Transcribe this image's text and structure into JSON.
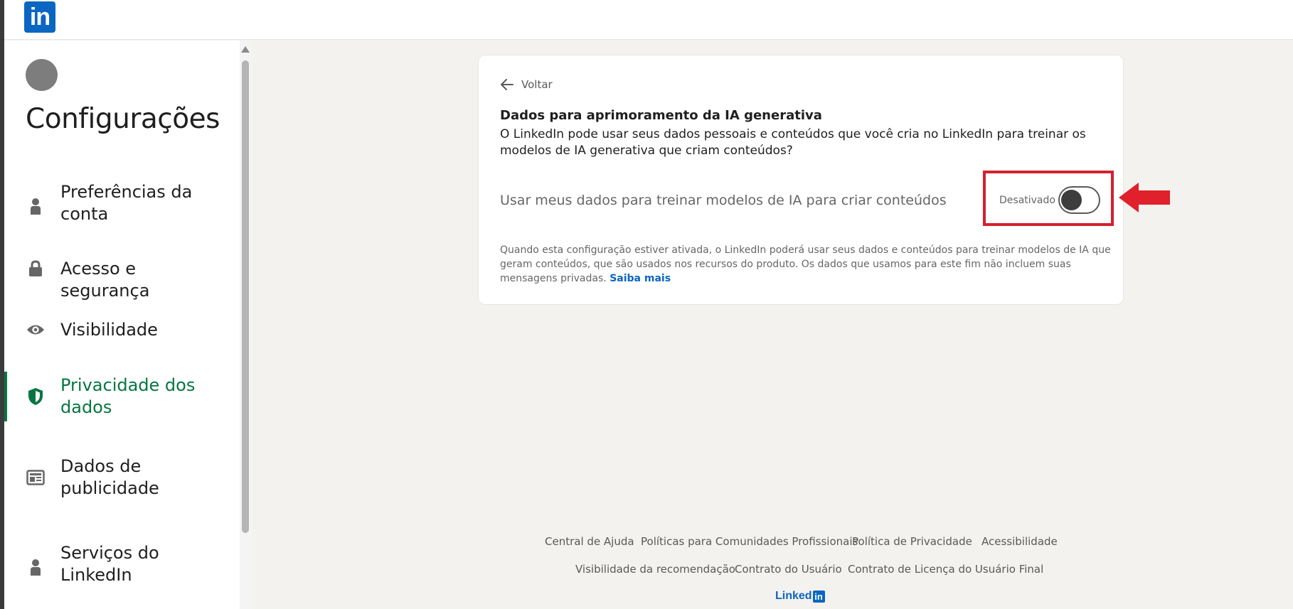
{
  "header": {
    "logo_text": "in"
  },
  "sidebar": {
    "title": "Configurações",
    "items": [
      {
        "label": "Preferências da conta",
        "icon": "person-icon",
        "active": false
      },
      {
        "label": "Acesso e segurança",
        "icon": "lock-icon",
        "active": false
      },
      {
        "label": "Visibilidade",
        "icon": "eye-icon",
        "active": false
      },
      {
        "label": "Privacidade dos dados",
        "icon": "shield-icon",
        "active": true
      },
      {
        "label": "Dados de publicidade",
        "icon": "newspaper-icon",
        "active": false
      },
      {
        "label": "Serviços do LinkedIn",
        "icon": "person-icon",
        "active": false
      }
    ]
  },
  "card": {
    "back_label": "Voltar",
    "title": "Dados para aprimoramento da IA generativa",
    "description": "O LinkedIn pode usar seus dados pessoais e conteúdos que você cria no LinkedIn para treinar os modelos de IA generativa que criam conteúdos?",
    "setting_label": "Usar meus dados para treinar modelos de IA para criar conteúdos",
    "toggle_state_label": "Desativado",
    "toggle_on": false,
    "note": "Quando esta configuração estiver ativada, o LinkedIn poderá usar seus dados e conteúdos para treinar modelos de IA que geram conteúdos, que são usados nos recursos do produto. Os dados que usamos para este fim não incluem suas mensagens privadas.",
    "learn_more": "Saiba mais"
  },
  "footer": {
    "links_row1": [
      "Central de Ajuda",
      "Políticas para Comunidades Profissionais",
      "Política de Privacidade",
      "Acessibilidade"
    ],
    "links_row2": [
      "Visibilidade da recomendação",
      "Contrato do Usuário",
      "Contrato de Licença do Usuário Final"
    ],
    "logo_word": "Linked",
    "logo_in": "in"
  },
  "colors": {
    "brand": "#0a66c2",
    "active_green": "#057642",
    "highlight_red": "#d4202f"
  }
}
